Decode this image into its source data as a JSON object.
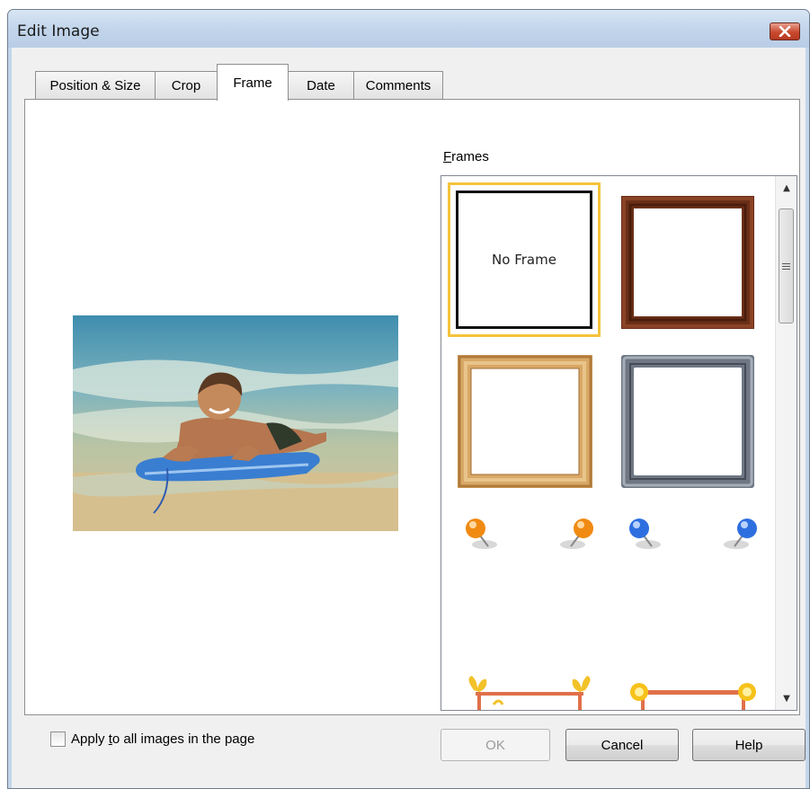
{
  "window": {
    "title": "Edit Image"
  },
  "tabs": [
    {
      "label": "Position & Size",
      "active": false
    },
    {
      "label": "Crop",
      "active": false
    },
    {
      "label": "Frame",
      "active": true
    },
    {
      "label": "Date",
      "active": false
    },
    {
      "label": "Comments",
      "active": false
    }
  ],
  "frames": {
    "label": "Frames",
    "mnemonic": "F",
    "items": [
      {
        "name": "No Frame",
        "label": "No Frame",
        "selected": true
      },
      {
        "name": "dark-wood-frame"
      },
      {
        "name": "light-wood-frame"
      },
      {
        "name": "metal-frame"
      },
      {
        "name": "orange-pins-frame"
      },
      {
        "name": "blue-pins-frame"
      },
      {
        "name": "butterfly-frame"
      },
      {
        "name": "flower-frame"
      }
    ]
  },
  "apply_all": {
    "label_prefix": "Apply ",
    "label_mnemonic": "t",
    "label_suffix": "o all images in the page",
    "checked": false
  },
  "buttons": {
    "ok": "OK",
    "cancel": "Cancel",
    "help": "Help"
  },
  "colors": {
    "selection": "#f5c33b",
    "title_bar": "#c4d6ea",
    "close": "#c9492e"
  }
}
